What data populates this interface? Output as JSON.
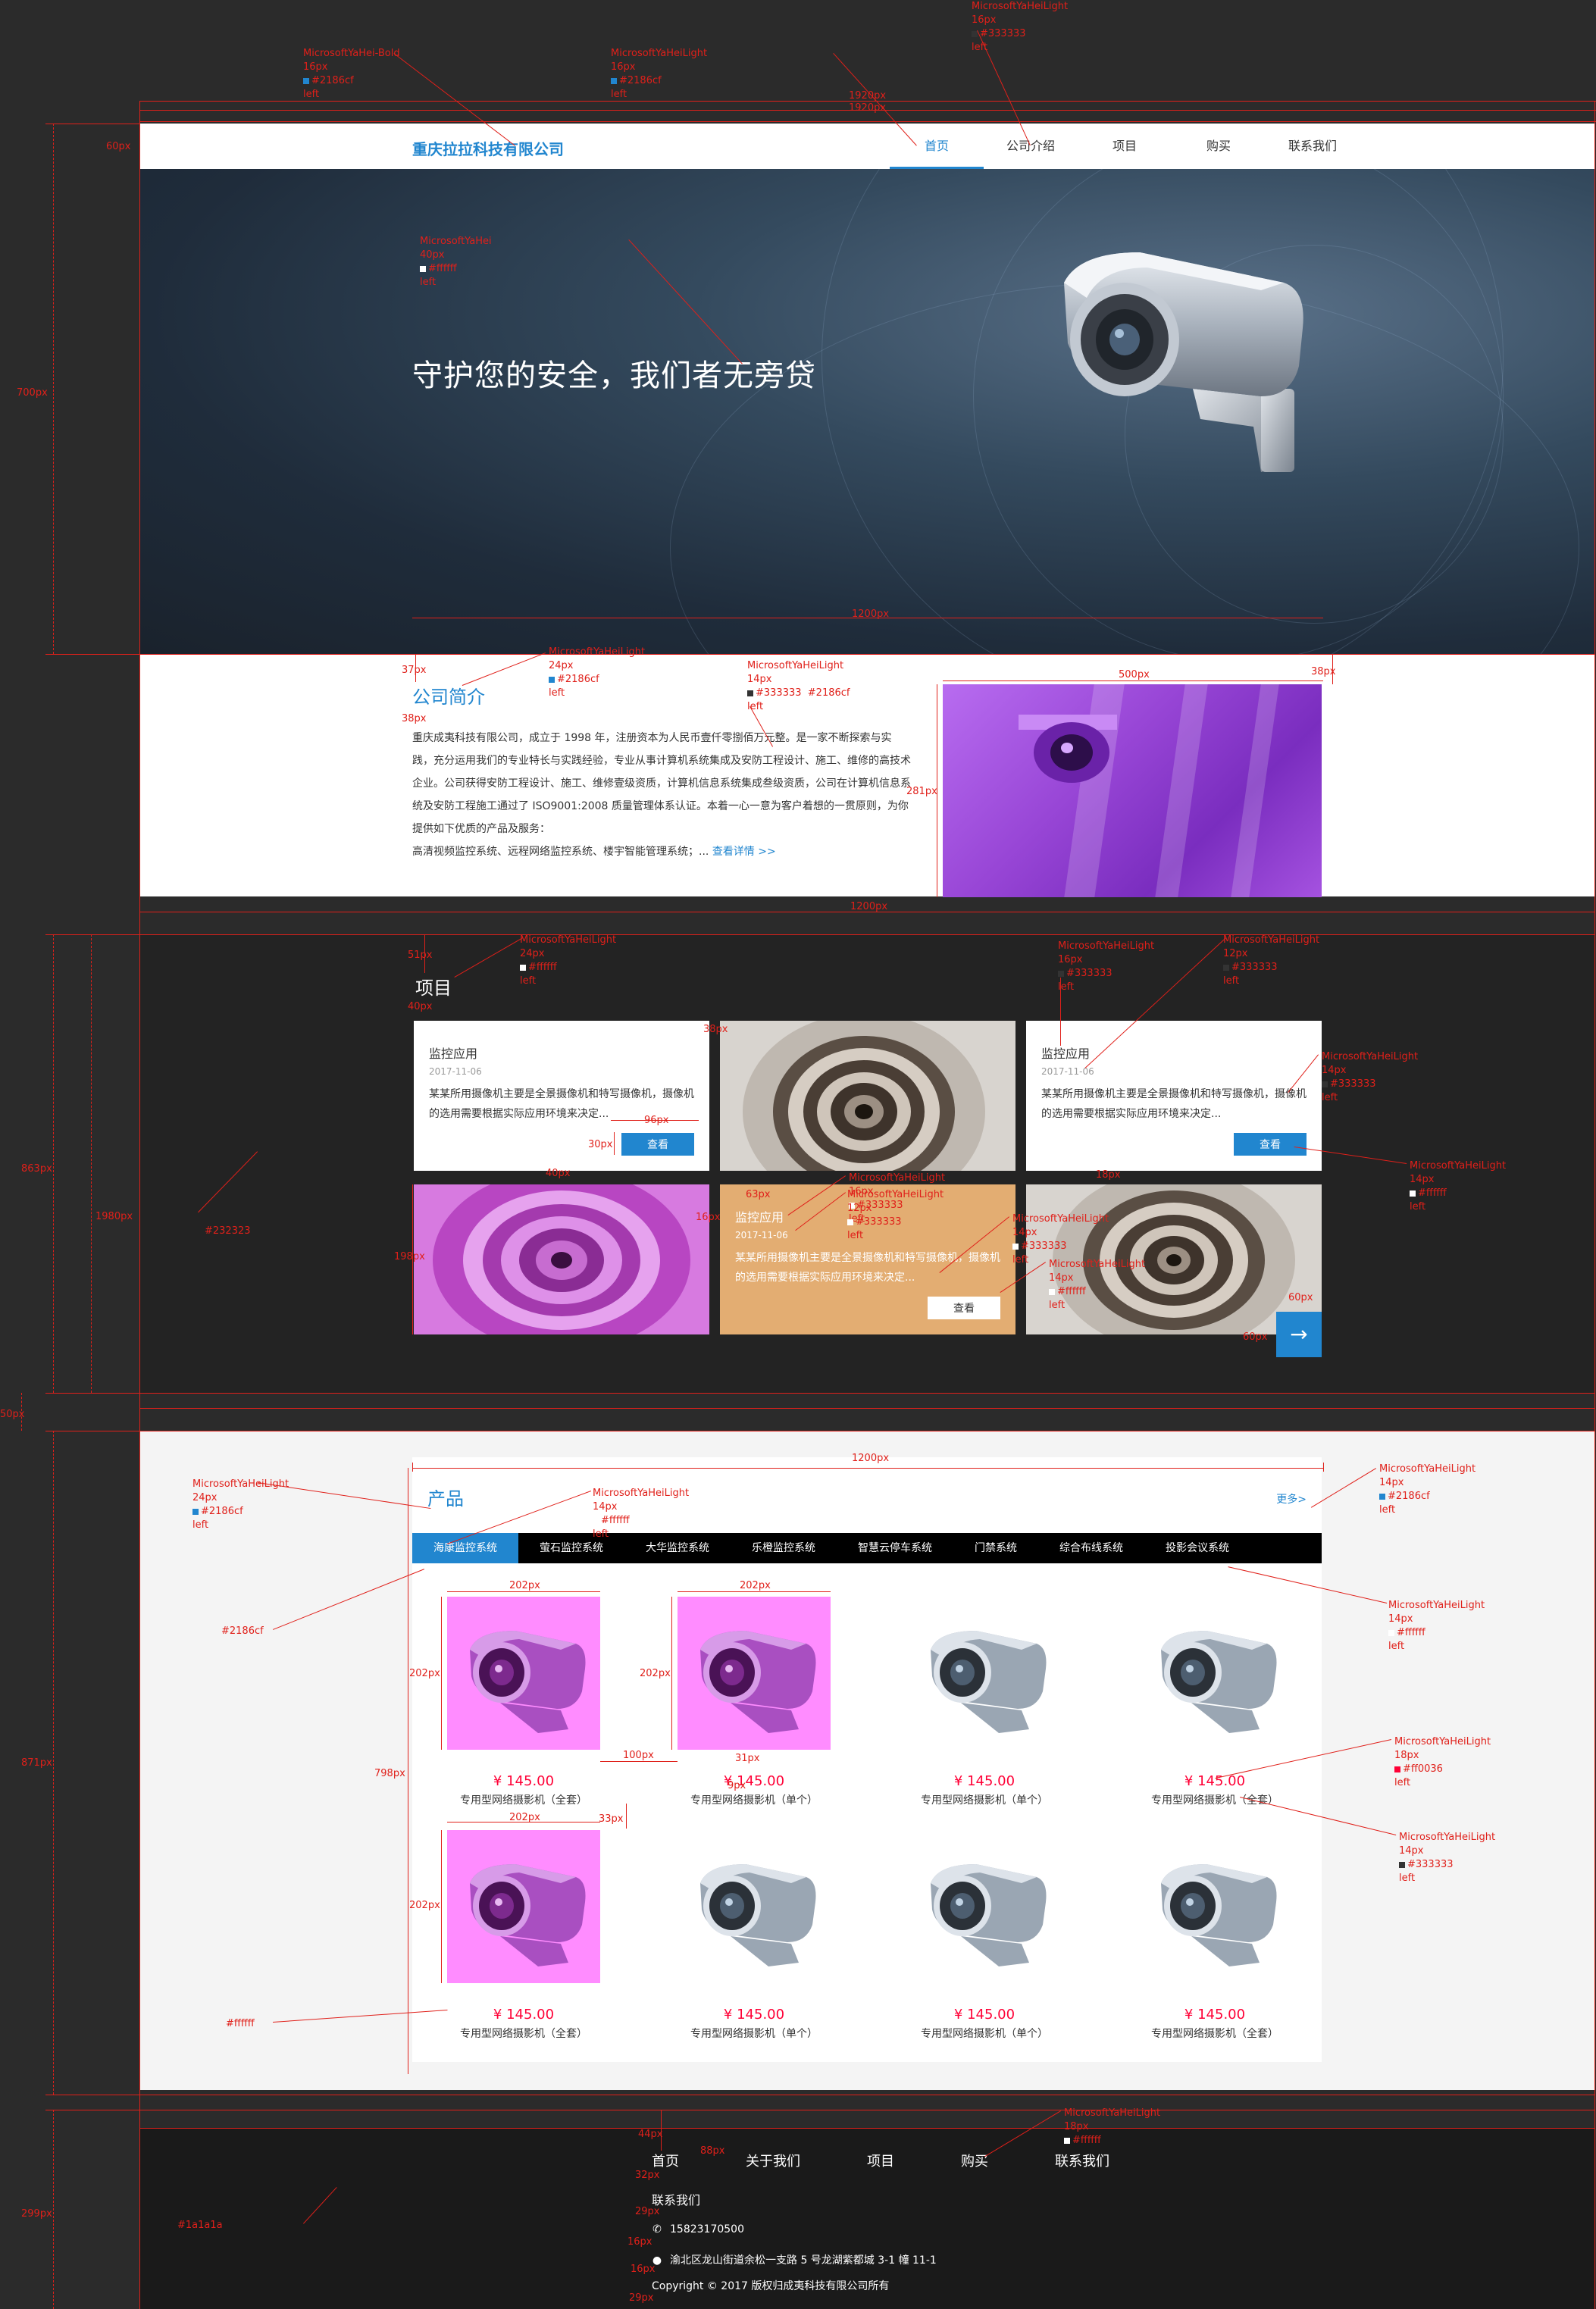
{
  "colors": {
    "brand": "#2186cf",
    "price": "#ff0036",
    "dark": "#232323",
    "footer": "#1a1a1a",
    "text": "#333333"
  },
  "header": {
    "logo": "重庆拉拉科技有限公司",
    "nav": [
      "首页",
      "公司介绍",
      "项目",
      "购买",
      "联系我们"
    ],
    "active_index": 0
  },
  "banner": {
    "title": "守护您的安全，我们者无旁贷"
  },
  "intro": {
    "title": "公司简介",
    "paragraphs": [
      "重庆成夷科技有限公司，成立于 1998 年，注册资本为人民币壹仟零捌佰万元整。是一家不断探索与实践，充分运用我们的专业特长与实践经验，专业从事计算机系统集成及安防工程设计、施工、维修的高技术企业。公司获得安防工程设计、施工、维修壹级资质，计算机信息系统集成叁级资质，公司在计算机信息系统及安防工程施工通过了 ISO9001:2008 质量管理体系认证。本着一心一意为客户着想的一贯原则，为你提供如下优质的产品及服务：",
      "高清视频监控系统、远程网络监控系统、楼宇智能管理系统；..."
    ],
    "more": "查看详情 >>"
  },
  "projects": {
    "title": "项目",
    "card_title": "监控应用",
    "card_date": "2017-11-06",
    "card_desc": "某某所用摄像机主要是全景摄像机和特写摄像机，摄像机的选用需要根据实际应用环境来决定...",
    "card_button": "查看",
    "next_icon": "arrow-right-icon"
  },
  "products": {
    "title": "产品",
    "more": "更多>",
    "tabs": [
      "海康监控系统",
      "萤石监控系统",
      "大华监控系统",
      "乐橙监控系统",
      "智慧云停车系统",
      "门禁系统",
      "综合布线系统",
      "投影会议系统"
    ],
    "active_tab": 0,
    "items": [
      {
        "price": "¥ 145.00",
        "name": "专用型网络摄影机（全套）"
      },
      {
        "price": "¥ 145.00",
        "name": "专用型网络摄影机（单个）"
      },
      {
        "price": "¥ 145.00",
        "name": "专用型网络摄影机（单个）"
      },
      {
        "price": "¥ 145.00",
        "name": "专用型网络摄影机（全套）"
      },
      {
        "price": "¥ 145.00",
        "name": "专用型网络摄影机（全套）"
      },
      {
        "price": "¥ 145.00",
        "name": "专用型网络摄影机（单个）"
      },
      {
        "price": "¥ 145.00",
        "name": "专用型网络摄影机（单个）"
      },
      {
        "price": "¥ 145.00",
        "name": "专用型网络摄影机（全套）"
      }
    ]
  },
  "footer": {
    "nav": [
      "首页",
      "关于我们",
      "项目",
      "购买",
      "联系我们"
    ],
    "contact_title": "联系我们",
    "phone": "15823170500",
    "address": "渝北区龙山街道余松一支路 5 号龙湖紫都城 3-1 幢 11-1",
    "copyright": "Copyright © 2017  版权归成夷科技有限公司所有"
  },
  "annotations": {
    "logo_spec": [
      "MicrosoftYaHei-Bold",
      "16px",
      "#2186cf",
      "left"
    ],
    "nav_spec": [
      "MicrosoftYaHeiLight",
      "16px",
      "#2186cf",
      "left"
    ],
    "nav_spec2": [
      "MicrosoftYaHeiLight",
      "16px",
      "#333333",
      "left"
    ],
    "banner_spec": [
      "MicrosoftYaHei",
      "40px",
      "#ffffff",
      "left"
    ],
    "intro_title_spec": [
      "MicrosoftYaHeiLight",
      "24px",
      "#2186cf",
      "left"
    ],
    "intro_text_spec": [
      "MicrosoftYaHeiLight",
      "14px",
      "#333333  #2186cf",
      "left"
    ],
    "proj_title_spec": [
      "MicrosoftYaHeiLight",
      "24px",
      "#ffffff",
      "left"
    ],
    "card_title_spec": [
      "MicrosoftYaHeiLight",
      "16px",
      "#333333",
      "left"
    ],
    "card_date_spec": [
      "MicrosoftYaHeiLight",
      "12px",
      "#333333",
      "left"
    ],
    "card_desc_spec": [
      "MicrosoftYaHeiLight",
      "14px",
      "#333333",
      "left"
    ],
    "card_btn_spec": [
      "MicrosoftYaHeiLight",
      "14px",
      "#ffffff",
      "left"
    ],
    "prod_title_spec": [
      "MicrosoftYaHeiLight",
      "24px",
      "#2186cf",
      "left"
    ],
    "tab_spec": [
      "MicrosoftYaHeiLight",
      "14px",
      "#ffffff",
      "left"
    ],
    "more_spec": [
      "MicrosoftYaHeiLight",
      "14px",
      "#2186cf",
      "left"
    ],
    "tab_right_spec": [
      "MicrosoftYaHeiLight",
      "14px",
      "#ffffff",
      "left"
    ],
    "price_spec": [
      "MicrosoftYaHeiLight",
      "18px",
      "#ff0036",
      "left"
    ],
    "name_spec": [
      "MicrosoftYaHeiLight",
      "14px",
      "#333333",
      "left"
    ],
    "footer_spec": [
      "MicrosoftYaHeiLight",
      "18px",
      "#ffffff"
    ],
    "swatch_dark": "#232323",
    "swatch_brand": "#2186cf",
    "swatch_white": "#ffffff",
    "swatch_footer": "#1a1a1a",
    "dims": {
      "w1920": "1920px",
      "w1200": "1200px",
      "w500": "500px",
      "w202": "202px",
      "w100": "100px",
      "w96": "96px",
      "h60": "60px",
      "h700": "700px",
      "h281": "281px",
      "h37": "37px",
      "h38": "38px",
      "h38b": "38px",
      "h51": "51px",
      "h40": "40px",
      "h30": "30px",
      "h198": "198px",
      "h863": "863px",
      "h1980": "1980px",
      "h50": "50px",
      "h871": "871px",
      "h798": "798px",
      "h31": "31px",
      "h33": "33px",
      "h9": "9px",
      "h63": "63px",
      "h16": "16px",
      "h18": "18px",
      "h60b": "60px",
      "h299": "299px",
      "h44": "44px",
      "h88": "88px",
      "h32": "32px",
      "h29": "29px",
      "h16b": "16px",
      "h16c": "16px",
      "h29b": "29px",
      "w1920b": "1920px",
      "w1200b": "1200px"
    }
  }
}
